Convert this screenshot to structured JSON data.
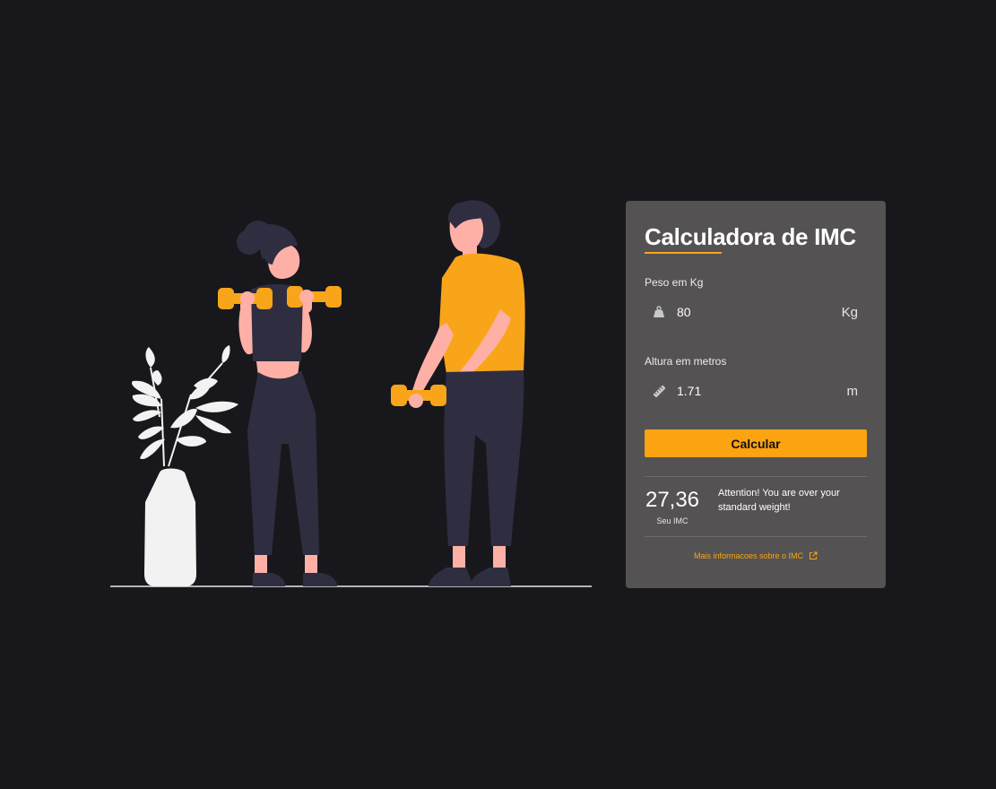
{
  "calculator": {
    "title": "Calculadora de IMC",
    "weight": {
      "label": "Peso em Kg",
      "value": "80",
      "unit": "Kg",
      "icon": "weight-icon"
    },
    "height": {
      "label": "Altura em metros",
      "value": "1.71",
      "unit": "m",
      "icon": "ruler-icon"
    },
    "button_label": "Calcular",
    "result": {
      "value": "27,36",
      "caption": "Seu IMC",
      "message": "Attention! You are over your standard weight!"
    },
    "more_info_label": "Mais informacoes sobre o IMC",
    "more_info_icon": "external-link-icon"
  },
  "colors": {
    "background": "#18181c",
    "card": "#545252",
    "accent": "#fca311"
  }
}
